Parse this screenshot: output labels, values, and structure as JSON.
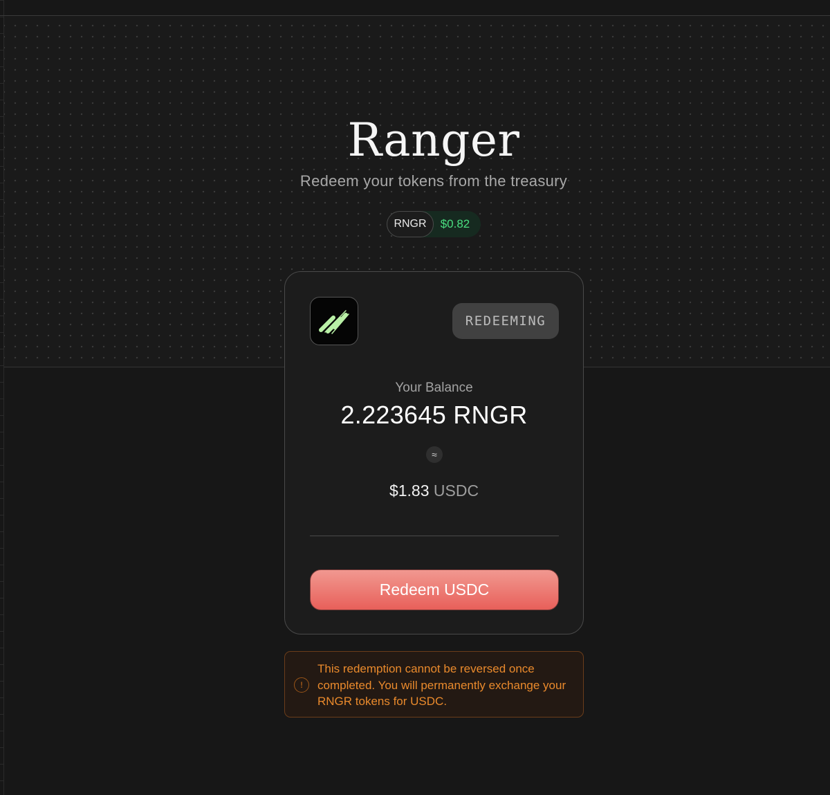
{
  "hero": {
    "title": "Ranger",
    "subtitle": "Redeem your tokens from the treasury"
  },
  "price_pill": {
    "symbol": "RNGR",
    "price": "$0.82"
  },
  "card": {
    "logo_icon": "ranger-logo-icon",
    "status": "REDEEMING",
    "balance_label": "Your Balance",
    "balance_value": "2.223645 RNGR",
    "approx_symbol": "≈",
    "usd_amount": "$1.83",
    "usd_unit": "USDC",
    "redeem_label": "Redeem USDC"
  },
  "warning": {
    "icon": "alert-circle-icon",
    "text": "This redemption cannot be reversed once completed. You will permanently exchange your RNGR tokens for USDC."
  },
  "colors": {
    "background": "#171717",
    "accent_green": "#4ade80",
    "logo_green": "#b9f0a6",
    "button_red": "#e8605a",
    "warning_orange": "#ea8a2c"
  }
}
